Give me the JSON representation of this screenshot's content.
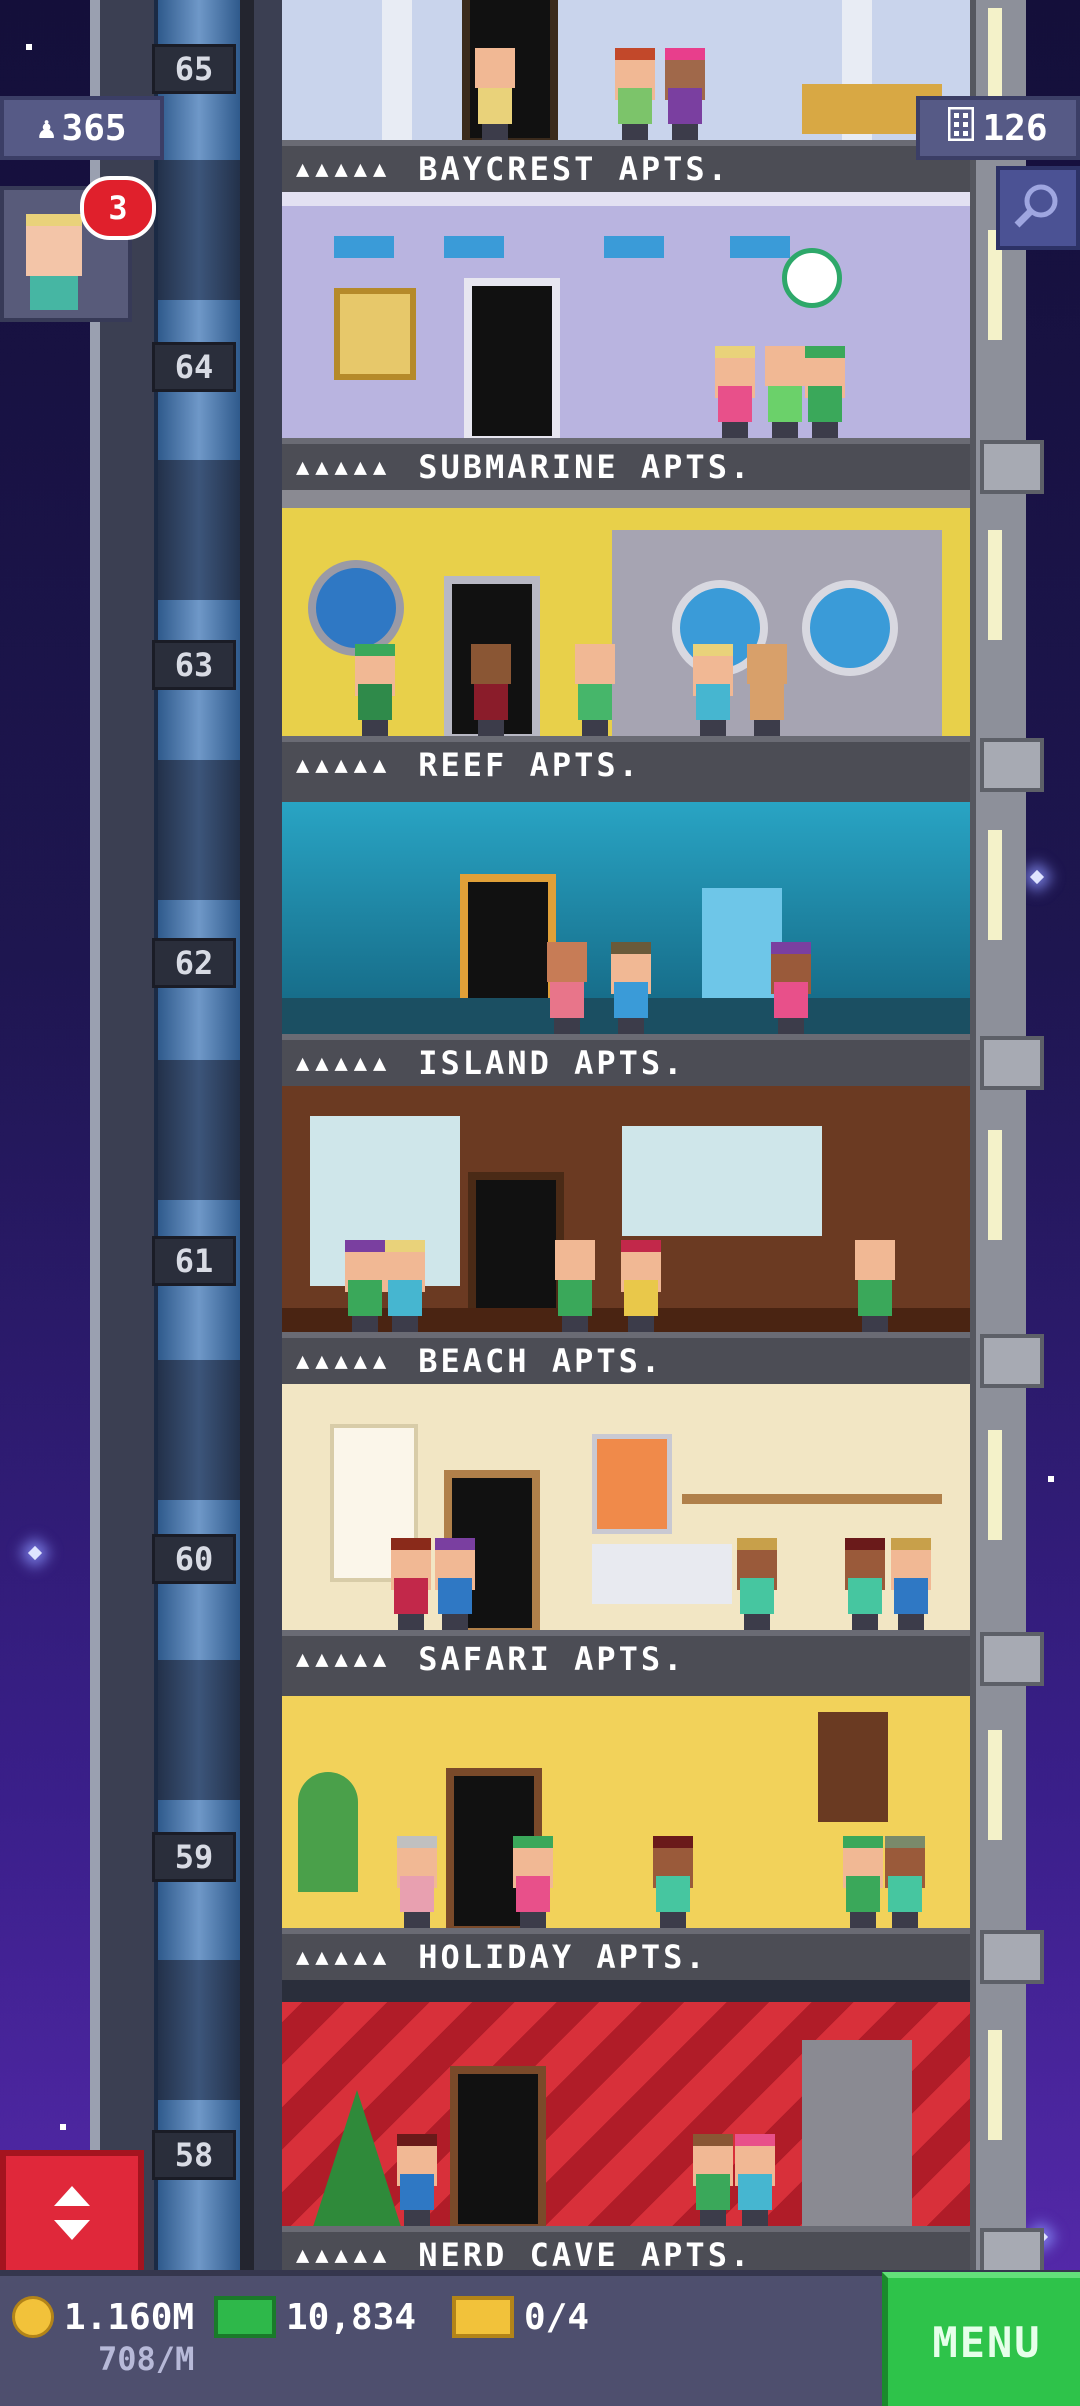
{
  "hud": {
    "population": "365",
    "population_icon": "person-icon",
    "floor_count": "126",
    "floor_icon": "building-icon",
    "search_icon": "magnifier-icon",
    "visitor_badge": "3"
  },
  "floors": [
    {
      "number": "65",
      "name": "BAYCREST APTS.",
      "bg": "#c9d4ec"
    },
    {
      "number": "64",
      "name": "SUBMARINE APTS.",
      "bg": "#b9b4e0"
    },
    {
      "number": "63",
      "name": "REEF APTS.",
      "bg": "#e8d04a"
    },
    {
      "number": "62",
      "name": "ISLAND APTS.",
      "bg": "#1a8fb0"
    },
    {
      "number": "61",
      "name": "BEACH APTS.",
      "bg": "#6b3a22"
    },
    {
      "number": "60",
      "name": "SAFARI APTS.",
      "bg": "#f2e6c4"
    },
    {
      "number": "59",
      "name": "HOLIDAY APTS.",
      "bg": "#f2d25a"
    },
    {
      "number": "58",
      "name": "NERD CAVE APTS.",
      "bg": "#d8303a"
    }
  ],
  "status": {
    "coins": "1.160M",
    "coins_rate": "708/M",
    "bux": "10,834",
    "tickets": "0/4"
  },
  "menu_label": "MENU",
  "colors": {
    "accent_green": "#2ec34a",
    "elevator_red": "#e0283a",
    "badge_red": "#e0202c"
  }
}
